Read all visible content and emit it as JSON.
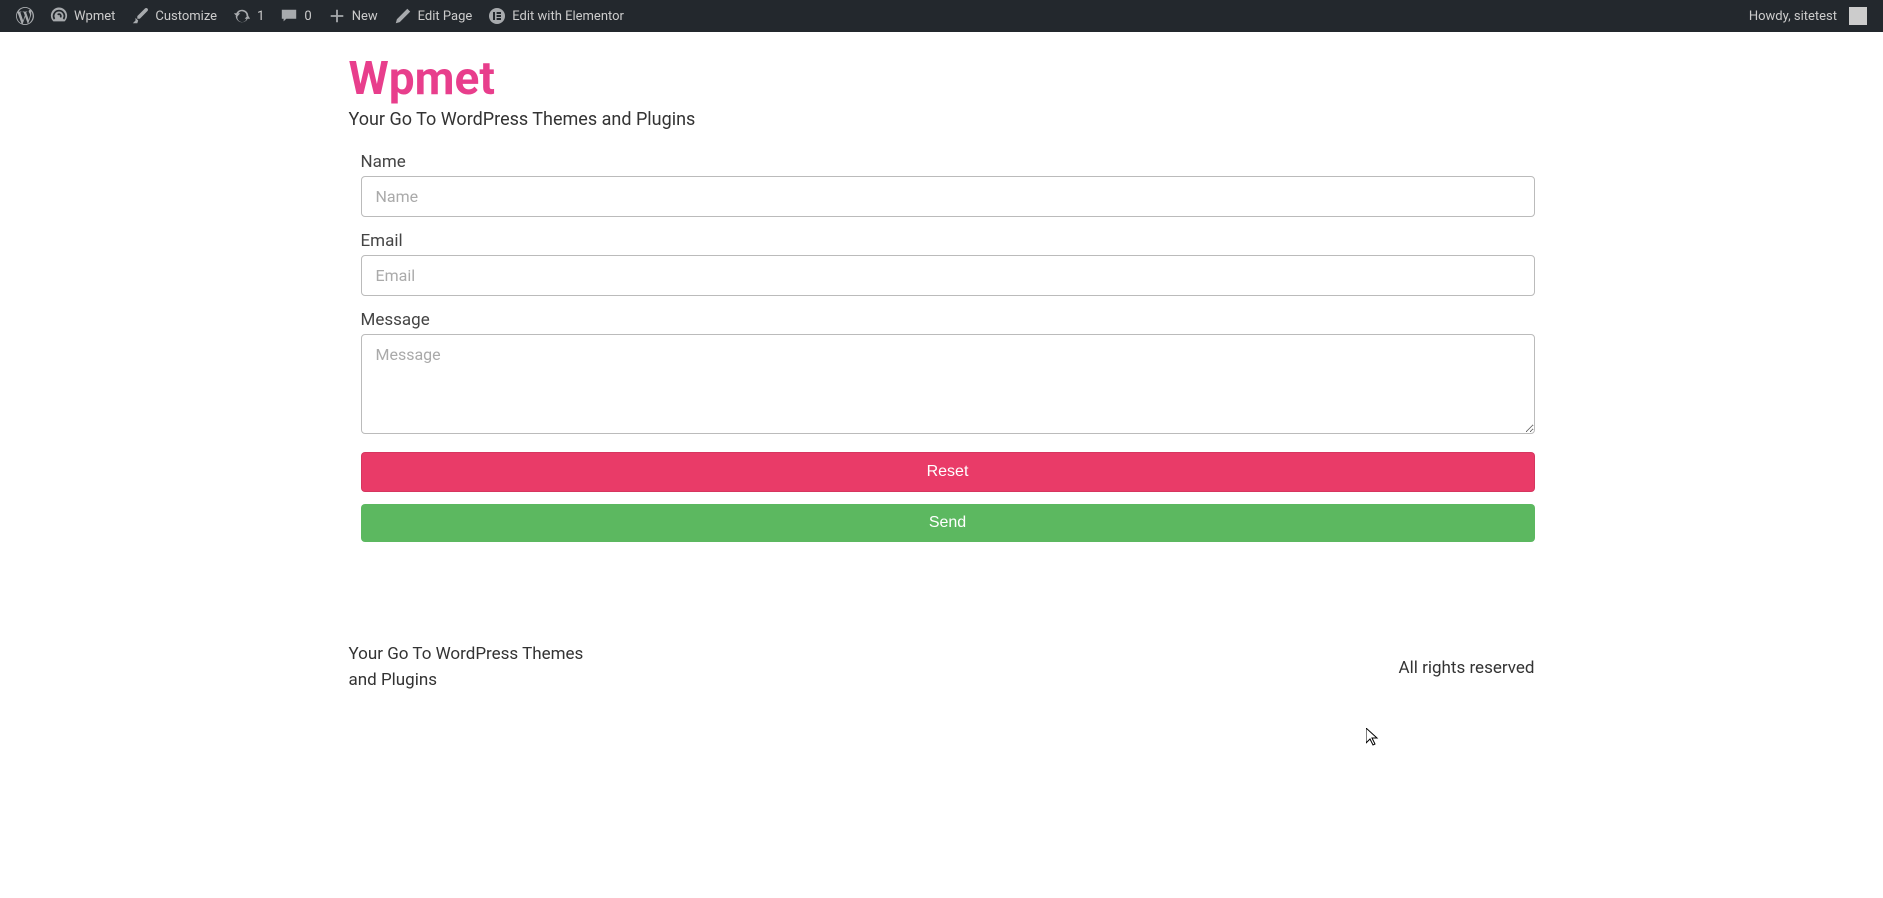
{
  "adminBar": {
    "siteName": "Wpmet",
    "customize": "Customize",
    "updates": "1",
    "comments": "0",
    "new": "New",
    "editPage": "Edit Page",
    "editElementor": "Edit with Elementor",
    "greeting": "Howdy, sitetest"
  },
  "header": {
    "siteTitle": "Wpmet",
    "tagline": "Your Go To WordPress Themes and Plugins"
  },
  "form": {
    "name": {
      "label": "Name",
      "placeholder": "Name"
    },
    "email": {
      "label": "Email",
      "placeholder": "Email"
    },
    "message": {
      "label": "Message",
      "placeholder": "Message"
    },
    "resetLabel": "Reset",
    "sendLabel": "Send"
  },
  "footer": {
    "leftText": "Your Go To WordPress Themes and Plugins",
    "rightText": "All rights reserved"
  }
}
